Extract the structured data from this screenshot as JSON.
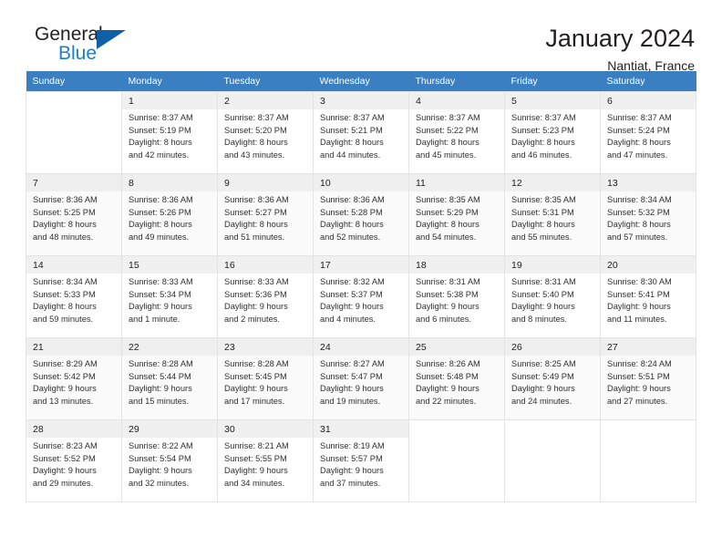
{
  "brand": {
    "name_top": "General",
    "name_bottom": "Blue",
    "triangle_color": "#1060a8",
    "blue_color": "#1b7fc4"
  },
  "header": {
    "title": "January 2024",
    "location": "Nantiat, France"
  },
  "calendar": {
    "header_bg": "#3a7fc1",
    "weekdays": [
      "Sunday",
      "Monday",
      "Tuesday",
      "Wednesday",
      "Thursday",
      "Friday",
      "Saturday"
    ],
    "labels": {
      "sunrise": "Sunrise:",
      "sunset": "Sunset:",
      "daylight": "Daylight:"
    },
    "weeks": [
      [
        {
          "day": "",
          "sunrise": "",
          "sunset": "",
          "daylight_1": "",
          "daylight_2": ""
        },
        {
          "day": "1",
          "sunrise": "Sunrise: 8:37 AM",
          "sunset": "Sunset: 5:19 PM",
          "daylight_1": "Daylight: 8 hours",
          "daylight_2": "and 42 minutes."
        },
        {
          "day": "2",
          "sunrise": "Sunrise: 8:37 AM",
          "sunset": "Sunset: 5:20 PM",
          "daylight_1": "Daylight: 8 hours",
          "daylight_2": "and 43 minutes."
        },
        {
          "day": "3",
          "sunrise": "Sunrise: 8:37 AM",
          "sunset": "Sunset: 5:21 PM",
          "daylight_1": "Daylight: 8 hours",
          "daylight_2": "and 44 minutes."
        },
        {
          "day": "4",
          "sunrise": "Sunrise: 8:37 AM",
          "sunset": "Sunset: 5:22 PM",
          "daylight_1": "Daylight: 8 hours",
          "daylight_2": "and 45 minutes."
        },
        {
          "day": "5",
          "sunrise": "Sunrise: 8:37 AM",
          "sunset": "Sunset: 5:23 PM",
          "daylight_1": "Daylight: 8 hours",
          "daylight_2": "and 46 minutes."
        },
        {
          "day": "6",
          "sunrise": "Sunrise: 8:37 AM",
          "sunset": "Sunset: 5:24 PM",
          "daylight_1": "Daylight: 8 hours",
          "daylight_2": "and 47 minutes."
        }
      ],
      [
        {
          "day": "7",
          "sunrise": "Sunrise: 8:36 AM",
          "sunset": "Sunset: 5:25 PM",
          "daylight_1": "Daylight: 8 hours",
          "daylight_2": "and 48 minutes."
        },
        {
          "day": "8",
          "sunrise": "Sunrise: 8:36 AM",
          "sunset": "Sunset: 5:26 PM",
          "daylight_1": "Daylight: 8 hours",
          "daylight_2": "and 49 minutes."
        },
        {
          "day": "9",
          "sunrise": "Sunrise: 8:36 AM",
          "sunset": "Sunset: 5:27 PM",
          "daylight_1": "Daylight: 8 hours",
          "daylight_2": "and 51 minutes."
        },
        {
          "day": "10",
          "sunrise": "Sunrise: 8:36 AM",
          "sunset": "Sunset: 5:28 PM",
          "daylight_1": "Daylight: 8 hours",
          "daylight_2": "and 52 minutes."
        },
        {
          "day": "11",
          "sunrise": "Sunrise: 8:35 AM",
          "sunset": "Sunset: 5:29 PM",
          "daylight_1": "Daylight: 8 hours",
          "daylight_2": "and 54 minutes."
        },
        {
          "day": "12",
          "sunrise": "Sunrise: 8:35 AM",
          "sunset": "Sunset: 5:31 PM",
          "daylight_1": "Daylight: 8 hours",
          "daylight_2": "and 55 minutes."
        },
        {
          "day": "13",
          "sunrise": "Sunrise: 8:34 AM",
          "sunset": "Sunset: 5:32 PM",
          "daylight_1": "Daylight: 8 hours",
          "daylight_2": "and 57 minutes."
        }
      ],
      [
        {
          "day": "14",
          "sunrise": "Sunrise: 8:34 AM",
          "sunset": "Sunset: 5:33 PM",
          "daylight_1": "Daylight: 8 hours",
          "daylight_2": "and 59 minutes."
        },
        {
          "day": "15",
          "sunrise": "Sunrise: 8:33 AM",
          "sunset": "Sunset: 5:34 PM",
          "daylight_1": "Daylight: 9 hours",
          "daylight_2": "and 1 minute."
        },
        {
          "day": "16",
          "sunrise": "Sunrise: 8:33 AM",
          "sunset": "Sunset: 5:36 PM",
          "daylight_1": "Daylight: 9 hours",
          "daylight_2": "and 2 minutes."
        },
        {
          "day": "17",
          "sunrise": "Sunrise: 8:32 AM",
          "sunset": "Sunset: 5:37 PM",
          "daylight_1": "Daylight: 9 hours",
          "daylight_2": "and 4 minutes."
        },
        {
          "day": "18",
          "sunrise": "Sunrise: 8:31 AM",
          "sunset": "Sunset: 5:38 PM",
          "daylight_1": "Daylight: 9 hours",
          "daylight_2": "and 6 minutes."
        },
        {
          "day": "19",
          "sunrise": "Sunrise: 8:31 AM",
          "sunset": "Sunset: 5:40 PM",
          "daylight_1": "Daylight: 9 hours",
          "daylight_2": "and 8 minutes."
        },
        {
          "day": "20",
          "sunrise": "Sunrise: 8:30 AM",
          "sunset": "Sunset: 5:41 PM",
          "daylight_1": "Daylight: 9 hours",
          "daylight_2": "and 11 minutes."
        }
      ],
      [
        {
          "day": "21",
          "sunrise": "Sunrise: 8:29 AM",
          "sunset": "Sunset: 5:42 PM",
          "daylight_1": "Daylight: 9 hours",
          "daylight_2": "and 13 minutes."
        },
        {
          "day": "22",
          "sunrise": "Sunrise: 8:28 AM",
          "sunset": "Sunset: 5:44 PM",
          "daylight_1": "Daylight: 9 hours",
          "daylight_2": "and 15 minutes."
        },
        {
          "day": "23",
          "sunrise": "Sunrise: 8:28 AM",
          "sunset": "Sunset: 5:45 PM",
          "daylight_1": "Daylight: 9 hours",
          "daylight_2": "and 17 minutes."
        },
        {
          "day": "24",
          "sunrise": "Sunrise: 8:27 AM",
          "sunset": "Sunset: 5:47 PM",
          "daylight_1": "Daylight: 9 hours",
          "daylight_2": "and 19 minutes."
        },
        {
          "day": "25",
          "sunrise": "Sunrise: 8:26 AM",
          "sunset": "Sunset: 5:48 PM",
          "daylight_1": "Daylight: 9 hours",
          "daylight_2": "and 22 minutes."
        },
        {
          "day": "26",
          "sunrise": "Sunrise: 8:25 AM",
          "sunset": "Sunset: 5:49 PM",
          "daylight_1": "Daylight: 9 hours",
          "daylight_2": "and 24 minutes."
        },
        {
          "day": "27",
          "sunrise": "Sunrise: 8:24 AM",
          "sunset": "Sunset: 5:51 PM",
          "daylight_1": "Daylight: 9 hours",
          "daylight_2": "and 27 minutes."
        }
      ],
      [
        {
          "day": "28",
          "sunrise": "Sunrise: 8:23 AM",
          "sunset": "Sunset: 5:52 PM",
          "daylight_1": "Daylight: 9 hours",
          "daylight_2": "and 29 minutes."
        },
        {
          "day": "29",
          "sunrise": "Sunrise: 8:22 AM",
          "sunset": "Sunset: 5:54 PM",
          "daylight_1": "Daylight: 9 hours",
          "daylight_2": "and 32 minutes."
        },
        {
          "day": "30",
          "sunrise": "Sunrise: 8:21 AM",
          "sunset": "Sunset: 5:55 PM",
          "daylight_1": "Daylight: 9 hours",
          "daylight_2": "and 34 minutes."
        },
        {
          "day": "31",
          "sunrise": "Sunrise: 8:19 AM",
          "sunset": "Sunset: 5:57 PM",
          "daylight_1": "Daylight: 9 hours",
          "daylight_2": "and 37 minutes."
        },
        {
          "day": "",
          "sunrise": "",
          "sunset": "",
          "daylight_1": "",
          "daylight_2": ""
        },
        {
          "day": "",
          "sunrise": "",
          "sunset": "",
          "daylight_1": "",
          "daylight_2": ""
        },
        {
          "day": "",
          "sunrise": "",
          "sunset": "",
          "daylight_1": "",
          "daylight_2": ""
        }
      ]
    ]
  }
}
